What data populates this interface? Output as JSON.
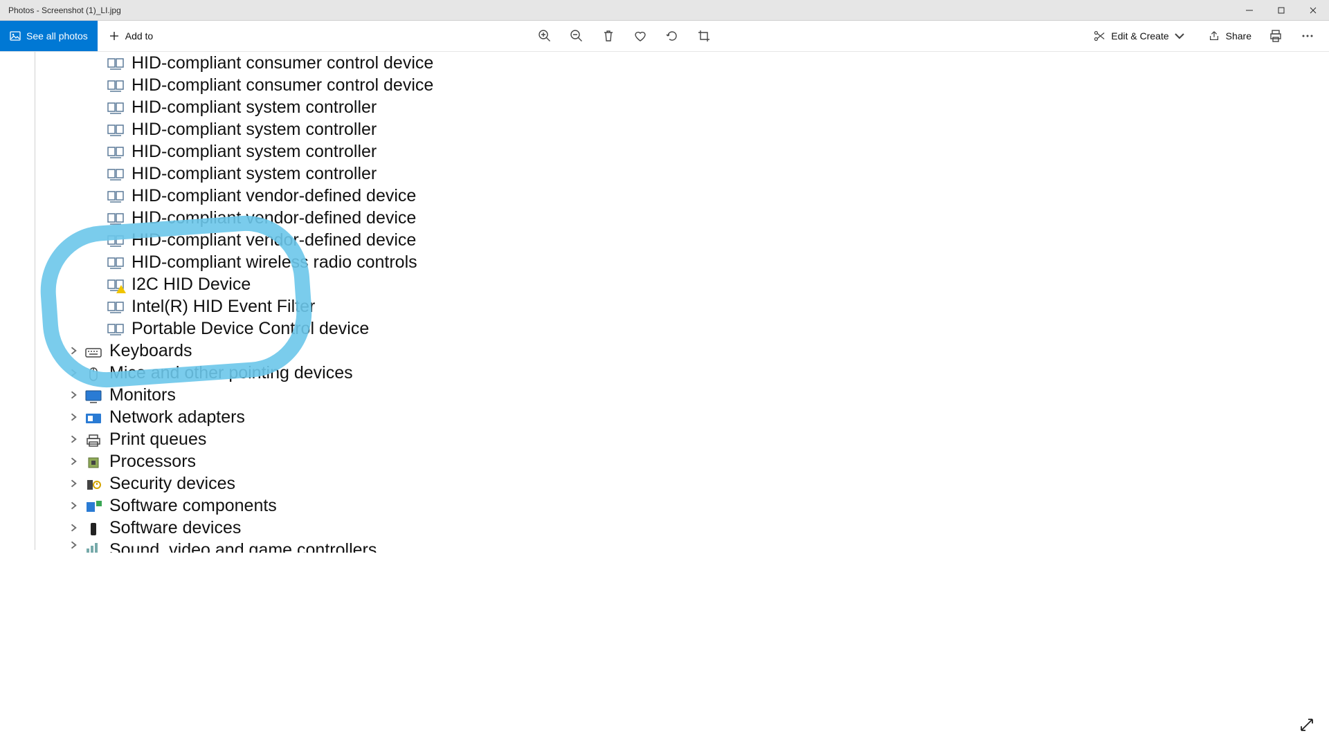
{
  "window": {
    "title": "Photos - Screenshot (1)_LI.jpg"
  },
  "toolbar": {
    "see_all": "See all photos",
    "add_to": "Add to",
    "edit_create": "Edit & Create",
    "share": "Share"
  },
  "colors": {
    "accent": "#0078d4",
    "annotation": "#6cc6ea"
  },
  "icons": {
    "minimize": "minimize-icon",
    "maximize": "maximize-icon",
    "close": "close-icon",
    "photos": "photos-icon",
    "plus": "plus-icon",
    "zoom_in": "zoom-in-icon",
    "zoom_out": "zoom-out-icon",
    "delete": "delete-icon",
    "favorite": "heart-icon",
    "rotate": "rotate-icon",
    "crop": "crop-icon",
    "edit": "scissors-icon",
    "chevron_down": "chevron-down-icon",
    "share": "share-icon",
    "print": "print-icon",
    "more": "more-icon",
    "fullscreen": "fullscreen-icon",
    "expand_arrow": "chevron-right-icon"
  },
  "deviceManager": {
    "hidDevices": [
      "HID-compliant consumer control device",
      "HID-compliant consumer control device",
      "HID-compliant system controller",
      "HID-compliant system controller",
      "HID-compliant system controller",
      "HID-compliant system controller",
      "HID-compliant vendor-defined device",
      "HID-compliant vendor-defined device",
      "HID-compliant vendor-defined device",
      "HID-compliant wireless radio controls",
      "I2C HID Device",
      "Intel(R) HID Event Filter",
      "Portable Device Control device"
    ],
    "deviceWithWarning": "I2C HID Device",
    "categories": [
      "Keyboards",
      "Mice and other pointing devices",
      "Monitors",
      "Network adapters",
      "Print queues",
      "Processors",
      "Security devices",
      "Software components",
      "Software devices",
      "Sound, video and game controllers"
    ],
    "categoryIcons": [
      "keyboard-icon",
      "mouse-icon",
      "monitor-icon",
      "network-icon",
      "printer-icon",
      "chip-icon",
      "security-icon",
      "component-icon",
      "software-device-icon",
      "audio-icon"
    ]
  }
}
